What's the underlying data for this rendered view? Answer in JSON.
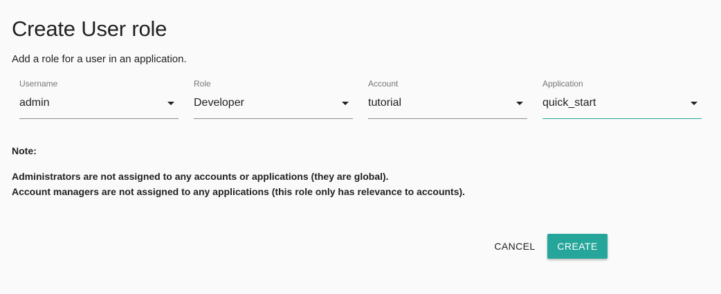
{
  "dialog": {
    "title": "Create User role",
    "subtitle": "Add a role for a user in an application."
  },
  "fields": {
    "username": {
      "label": "Username",
      "value": "admin"
    },
    "role": {
      "label": "Role",
      "value": "Developer"
    },
    "account": {
      "label": "Account",
      "value": "tutorial"
    },
    "application": {
      "label": "Application",
      "value": "quick_start"
    }
  },
  "note": {
    "heading": "Note:",
    "lines": [
      "Administrators are not assigned to any accounts or applications (they are global).",
      "Account managers are not assigned to any applications (this role only has relevance to accounts)."
    ]
  },
  "actions": {
    "cancel_label": "CANCEL",
    "create_label": "CREATE"
  },
  "colors": {
    "accent": "#26a69a",
    "background": "#fafafa"
  },
  "icons": {
    "dropdown": "triangle-down-icon"
  }
}
